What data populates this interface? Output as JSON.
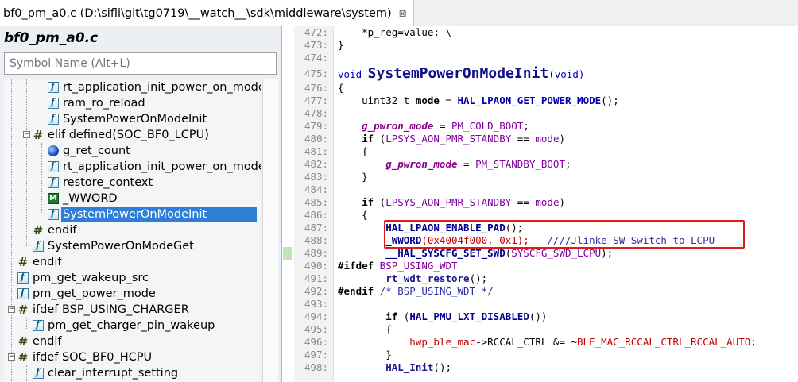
{
  "window": {
    "tab_title": "bf0_pm_a0.c (D:\\sifli\\git\\tg0719\\__watch__\\sdk\\middleware\\system)",
    "tab_close": "⊠"
  },
  "symbols": {
    "title": "bf0_pm_a0.c",
    "search_placeholder": "Symbol Name (Alt+L)",
    "items": [
      {
        "label": "rt_application_init_power_on_mode",
        "icon": "function-icon"
      },
      {
        "label": "ram_ro_reload",
        "icon": "function-icon"
      },
      {
        "label": "SystemPowerOnModeInit",
        "icon": "function-icon"
      },
      {
        "label": "elif defined(SOC_BF0_LCPU)",
        "icon": "preprocessor-icon"
      },
      {
        "label": "g_ret_count",
        "icon": "global-variable-icon"
      },
      {
        "label": "rt_application_init_power_on_mode",
        "icon": "function-icon"
      },
      {
        "label": "restore_context",
        "icon": "function-icon"
      },
      {
        "label": "_WWORD",
        "icon": "macro-icon"
      },
      {
        "label": "SystemPowerOnModeInit",
        "icon": "function-icon",
        "selected": true
      },
      {
        "label": "endif",
        "icon": "preprocessor-icon"
      },
      {
        "label": "SystemPowerOnModeGet",
        "icon": "function-icon"
      },
      {
        "label": "endif",
        "icon": "preprocessor-icon"
      },
      {
        "label": "pm_get_wakeup_src",
        "icon": "function-icon"
      },
      {
        "label": "pm_get_power_mode",
        "icon": "function-icon"
      },
      {
        "label": "ifdef BSP_USING_CHARGER",
        "icon": "preprocessor-icon"
      },
      {
        "label": "pm_get_charger_pin_wakeup",
        "icon": "function-icon"
      },
      {
        "label": "endif",
        "icon": "preprocessor-icon"
      },
      {
        "label": "ifdef SOC_BF0_HCPU",
        "icon": "preprocessor-icon"
      },
      {
        "label": "clear_interrupt_setting",
        "icon": "function-icon"
      }
    ]
  },
  "editor": {
    "line_numbers": [
      "472:",
      "473:",
      "474:",
      "475:",
      "476:",
      "477:",
      "478:",
      "479:",
      "480:",
      "481:",
      "482:",
      "483:",
      "484:",
      "485:",
      "486:",
      "487:",
      "488:",
      "489:",
      "490:",
      "491:",
      "492:",
      "493:",
      "494:",
      "495:",
      "496:",
      "497:",
      "498:"
    ],
    "lines": {
      "l472": "    *p_reg=value; \\",
      "l473": "}",
      "l475_kw": "void",
      "l475_fn": "SystemPowerOnModeInit",
      "l475_args": "(void)",
      "l476": "{",
      "l477_type": "    uint32_t",
      "l477_var": "mode",
      "l477_eq": " = ",
      "l477_macro": "HAL_LPAON_GET_POWER_MODE",
      "l477_tail": "();",
      "l479_var": "    g_pwron_mode",
      "l479_eq": " = ",
      "l479_val": "PM_COLD_BOOT",
      "l479_tail": ";",
      "l480_if": "    if",
      "l480_open": " (",
      "l480_cond": "LPSYS_AON_PMR_STANDBY",
      "l480_mid": " == ",
      "l480_mode": "mode",
      "l480_close": ")",
      "l481": "    {",
      "l482_var": "        g_pwron_mode",
      "l482_eq": " = ",
      "l482_val": "PM_STANDBY_BOOT",
      "l482_tail": ";",
      "l483": "    }",
      "l485_if": "    if",
      "l485_open": " (",
      "l485_cond": "LPSYS_AON_PMR_STANDBY",
      "l485_mid": " == ",
      "l485_mode": "mode",
      "l485_close": ")",
      "l486": "    {",
      "l487_macro": "        HAL_LPAON_ENABLE_PAD",
      "l487_tail": "();",
      "l488_macro": "        _WWORD",
      "l488_args": "(0x4004f000, 0x1);",
      "l488_comment": "   ////Jlinke SW Switch to LCPU",
      "l489_macro": "        __HAL_SYSCFG_SET_SWD",
      "l489_open": "(",
      "l489_arg": "SYSCFG_SWD_LCPU",
      "l489_tail": ");",
      "l490_pp": "#ifdef",
      "l490_sym": " BSP_USING_WDT",
      "l491_fn": "        rt_wdt_restore",
      "l491_tail": "();",
      "l492_pp": "#endif",
      "l492_comment": " /* BSP_USING_WDT */",
      "l494_if": "        if",
      "l494_open": " (",
      "l494_macro": "HAL_PMU_LXT_DISABLED",
      "l494_tail": "())",
      "l495": "        {",
      "l496_var": "            hwp_ble_mac",
      "l496_arrow": "->RCCAL_CTRL &= ~",
      "l496_macro": "BLE_MAC_RCCAL_CTRL_RCCAL_AUTO",
      "l496_tail": ";",
      "l497": "        }",
      "l498_fn": "        HAL_Init",
      "l498_tail": "();"
    }
  }
}
